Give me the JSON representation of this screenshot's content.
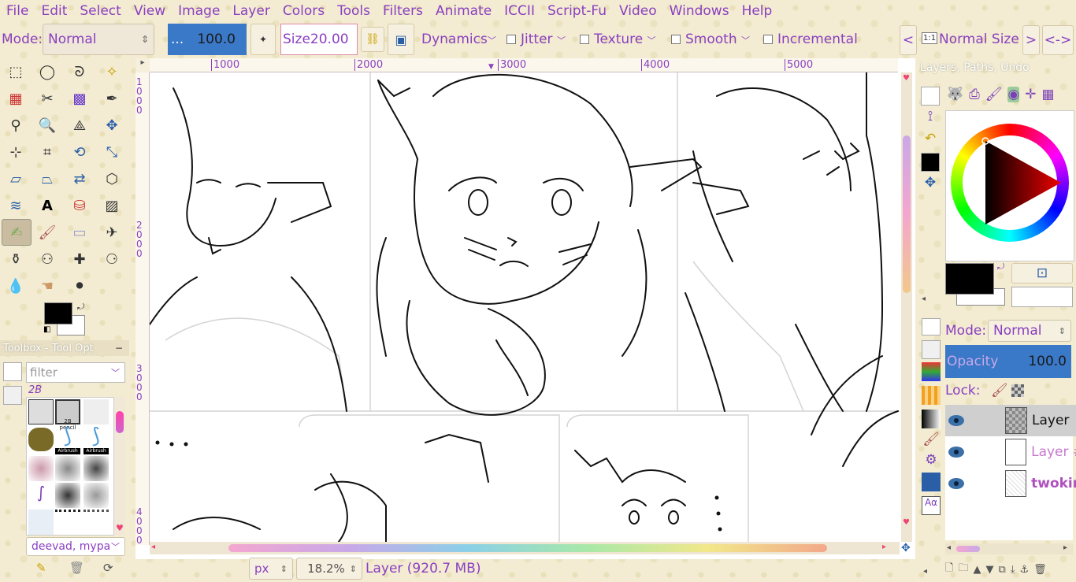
{
  "menu": [
    "File",
    "Edit",
    "Select",
    "View",
    "Image",
    "Layer",
    "Colors",
    "Tools",
    "Filters",
    "Animate",
    "ICCII",
    "Script-Fu",
    "Video",
    "Windows",
    "Help"
  ],
  "tool_options": {
    "mode_label": "Mode:",
    "mode_value": "Normal",
    "opacity_prefix": "...",
    "opacity_value": "100.0",
    "size_label": "Size",
    "size_value": "20.00",
    "dynamics": "Dynamics",
    "jitter": "Jitter",
    "texture": "Texture",
    "smooth": "Smooth",
    "incremental": "Incremental",
    "prev": "<",
    "view_icon": "1:1",
    "view_size": "Normal Size",
    "next": ">",
    "expand": "<->"
  },
  "ruler": {
    "h": [
      "1000",
      "2000",
      "3000",
      "4000",
      "5000"
    ],
    "v": [
      "1000",
      "2000",
      "3000",
      "4000"
    ]
  },
  "toolbox_panel": {
    "title": "Toolbox - Tool Opt",
    "filter_placeholder": "filter",
    "brush_set": "2B",
    "brush_thumb_label": "2B pencil",
    "tag": "deevad, mypa",
    "brush_labels": [
      "Airbrush Ext",
      "Airbrush Ext"
    ]
  },
  "status": {
    "unit": "px",
    "zoom": "18.2%",
    "layer_info": "Layer (920.7 MB)"
  },
  "right_panel": {
    "tabs_title": "Layers, Paths, Undo",
    "mode_label": "Mode:",
    "mode_value": "Normal",
    "opacity_label": "Opacity",
    "opacity_value": "100.0",
    "lock_label": "Lock:",
    "layers": [
      {
        "name": "Layer",
        "active": true
      },
      {
        "name": "Layer #",
        "active": false
      },
      {
        "name": "twokin",
        "active": false
      }
    ],
    "fg_color": "#000000",
    "bg_color": "#ffffff"
  },
  "colors": {
    "accent": "#8a3fc0",
    "selection_blue": "#3a78c8"
  }
}
